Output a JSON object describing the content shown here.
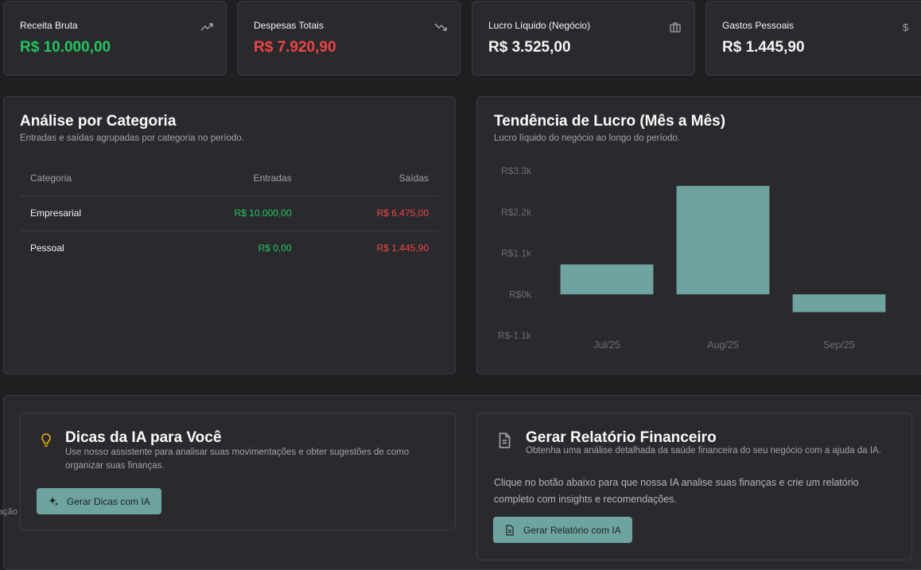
{
  "kpis": [
    {
      "title": "Receita Bruta",
      "value": "R$ 10.000,00",
      "color": "#22c55e",
      "icon": "trending-up-icon"
    },
    {
      "title": "Despesas Totais",
      "value": "R$ 7.920,90",
      "color": "#ef4444",
      "icon": "trending-down-icon"
    },
    {
      "title": "Lucro Líquido (Negócio)",
      "value": "R$ 3.525,00",
      "color": "#f4f4f5",
      "icon": "briefcase-icon"
    },
    {
      "title": "Gastos Pessoais",
      "value": "R$ 1.445,90",
      "color": "#f4f4f5",
      "icon": "dollar-icon"
    }
  ],
  "category": {
    "title": "Análise por Categoria",
    "subtitle": "Entradas e saídas agrupadas por categoria no período.",
    "headers": [
      "Categoria",
      "Entradas",
      "Saídas"
    ],
    "rows": [
      [
        "Empresarial",
        "R$ 10.000,00",
        "R$ 6.475,00"
      ],
      [
        "Pessoal",
        "R$ 0,00",
        "R$ 1.445,90"
      ]
    ]
  },
  "trend": {
    "title": "Tendência de Lucro (Mês a Mês)",
    "subtitle": "Lucro líquido do negócio ao longo do período."
  },
  "chart_data": {
    "type": "bar",
    "categories": [
      "Jul/25",
      "Aug/25",
      "Sep/25"
    ],
    "values": [
      800,
      2900,
      -475
    ],
    "ytick_labels": [
      "R$3.3k",
      "R$2.2k",
      "R$1.1k",
      "R$0k",
      "R$-1.1k"
    ],
    "ytick_values": [
      3300,
      2200,
      1100,
      0,
      -1100
    ],
    "ylim": [
      -1100,
      3300
    ],
    "bar_color": "#6fa3a0",
    "grid": false
  },
  "tips": {
    "title": "Dicas da IA para Você",
    "subtitle": "Use nosso assistente para analisar suas movimentações e obter sugestões de como organizar suas finanças.",
    "button": "Gerar Dicas com IA"
  },
  "report": {
    "title": "Gerar Relatório Financeiro",
    "subtitle": "Obtenha uma análise detalhada da saúde financeira do seu negócio com a ajuda da IA.",
    "body": "Clique no botão abaixo para que nossa IA analise suas finanças e crie um relatório completo com insights e recomendações.",
    "button": "Gerar Relatório com IA"
  },
  "sidebar_fragment": "ação"
}
